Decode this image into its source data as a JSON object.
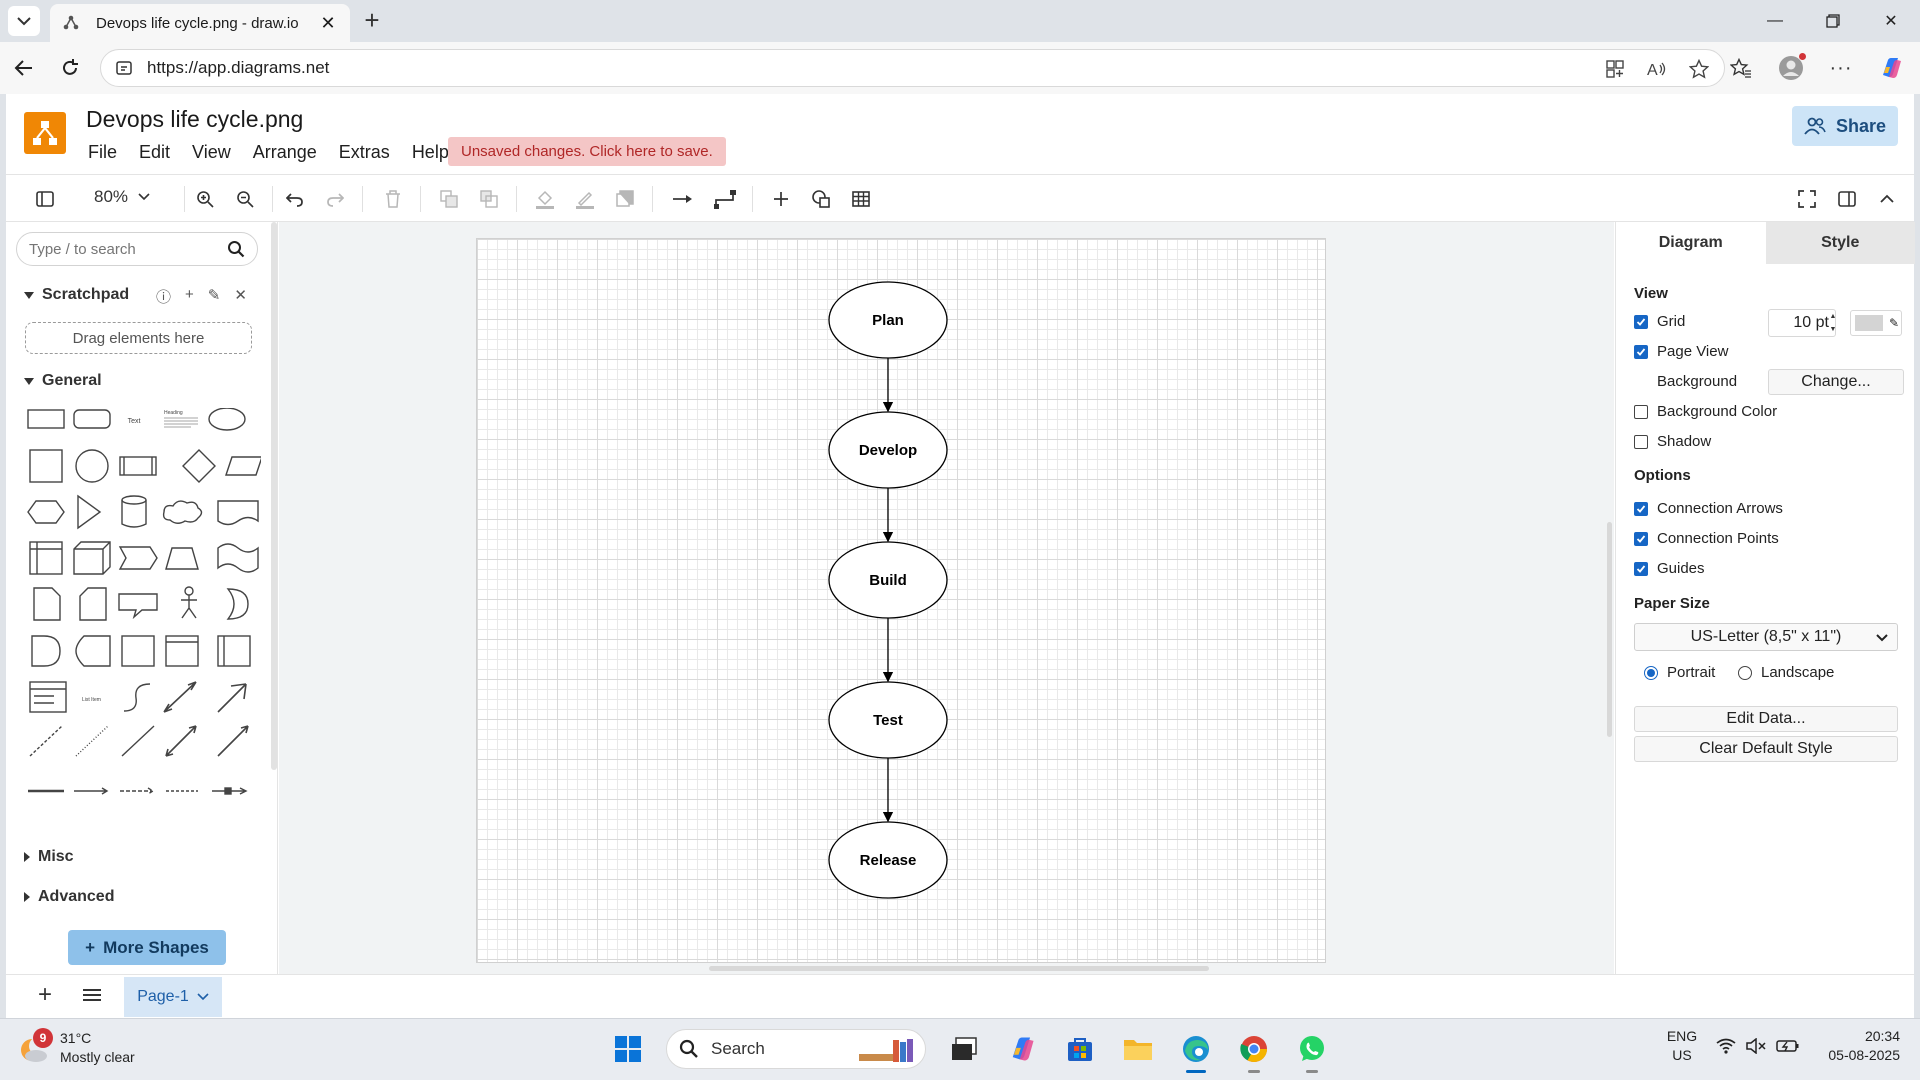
{
  "browser": {
    "tab_title": "Devops life cycle.png - draw.io",
    "url": "https://app.diagrams.net"
  },
  "app": {
    "file_title": "Devops life cycle.png",
    "menu": [
      "File",
      "Edit",
      "View",
      "Arrange",
      "Extras",
      "Help"
    ],
    "unsaved_notice": "Unsaved changes. Click here to save.",
    "share_label": "Share"
  },
  "toolbar": {
    "zoom": "80%"
  },
  "sidebar": {
    "search_placeholder": "Type / to search",
    "scratchpad_title": "Scratchpad",
    "drag_hint": "Drag elements here",
    "general_title": "General",
    "misc_title": "Misc",
    "advanced_title": "Advanced",
    "more_shapes_label": "More Shapes",
    "shape_text_label": "Text",
    "shape_heading_label": "Heading",
    "shape_list_label": "List Item"
  },
  "diagram": {
    "nodes": [
      "Plan",
      "Develop",
      "Build",
      "Test",
      "Release"
    ],
    "edges": [
      [
        "Plan",
        "Develop"
      ],
      [
        "Develop",
        "Build"
      ],
      [
        "Build",
        "Test"
      ],
      [
        "Test",
        "Release"
      ]
    ]
  },
  "format_panel": {
    "tabs": [
      "Diagram",
      "Style"
    ],
    "view_title": "View",
    "grid_label": "Grid",
    "grid_size": "10 pt",
    "page_view_label": "Page View",
    "background_label": "Background",
    "change_label": "Change...",
    "background_color_label": "Background Color",
    "shadow_label": "Shadow",
    "options_title": "Options",
    "connection_arrows_label": "Connection Arrows",
    "connection_points_label": "Connection Points",
    "guides_label": "Guides",
    "paper_size_title": "Paper Size",
    "paper_size": "US-Letter (8,5\" x 11\")",
    "portrait_label": "Portrait",
    "landscape_label": "Landscape",
    "edit_data_label": "Edit Data...",
    "clear_style_label": "Clear Default Style",
    "checks": {
      "grid": true,
      "page_view": true,
      "background_color": false,
      "shadow": false,
      "connection_arrows": true,
      "connection_points": true,
      "guides": true
    },
    "orientation": "portrait"
  },
  "pages": {
    "current": "Page-1"
  },
  "taskbar": {
    "weather_badge": "9",
    "temperature": "31°C",
    "weather_desc": "Mostly clear",
    "search_label": "Search",
    "lang_line1": "ENG",
    "lang_line2": "US",
    "time": "20:34",
    "date": "05-08-2025"
  },
  "colors": {
    "drawio_orange": "#f08705",
    "unsaved_bg": "#f4c6c6",
    "unsaved_text": "#b02727",
    "share_bg": "#cde4f7",
    "accent_blue": "#1666c5"
  }
}
